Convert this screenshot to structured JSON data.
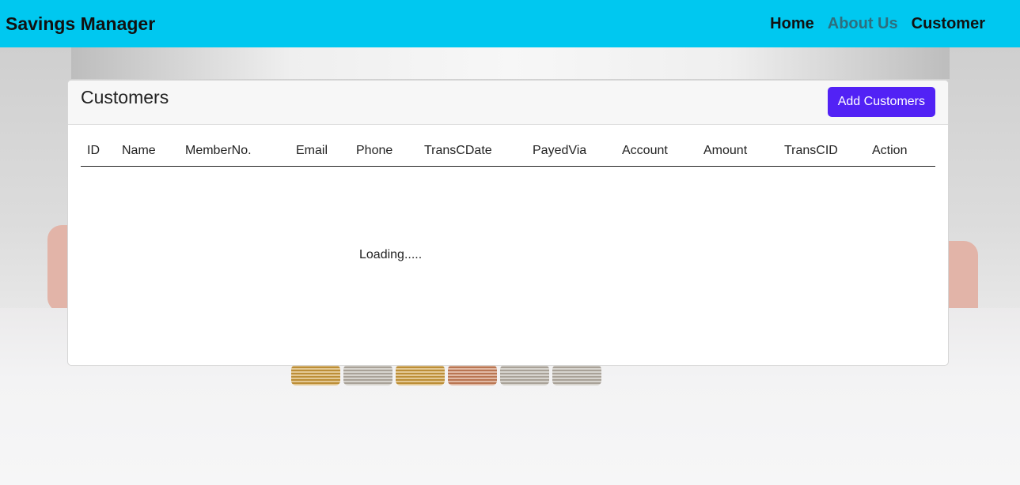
{
  "navbar": {
    "brand": "Savings Manager",
    "links": [
      {
        "label": "Home"
      },
      {
        "label": "About Us"
      },
      {
        "label": "Customer"
      }
    ],
    "background_color": "#00c8f0"
  },
  "card": {
    "title": "Customers",
    "add_button_label": "Add Customers",
    "accent_color": "#5222f5",
    "table": {
      "headers": [
        "ID",
        "Name",
        "MemberNo.",
        "Email",
        "Phone",
        "TransCDate",
        "PayedVia",
        "Account",
        "Amount",
        "TransCID",
        "Action"
      ]
    },
    "loading_text": "Loading....."
  }
}
